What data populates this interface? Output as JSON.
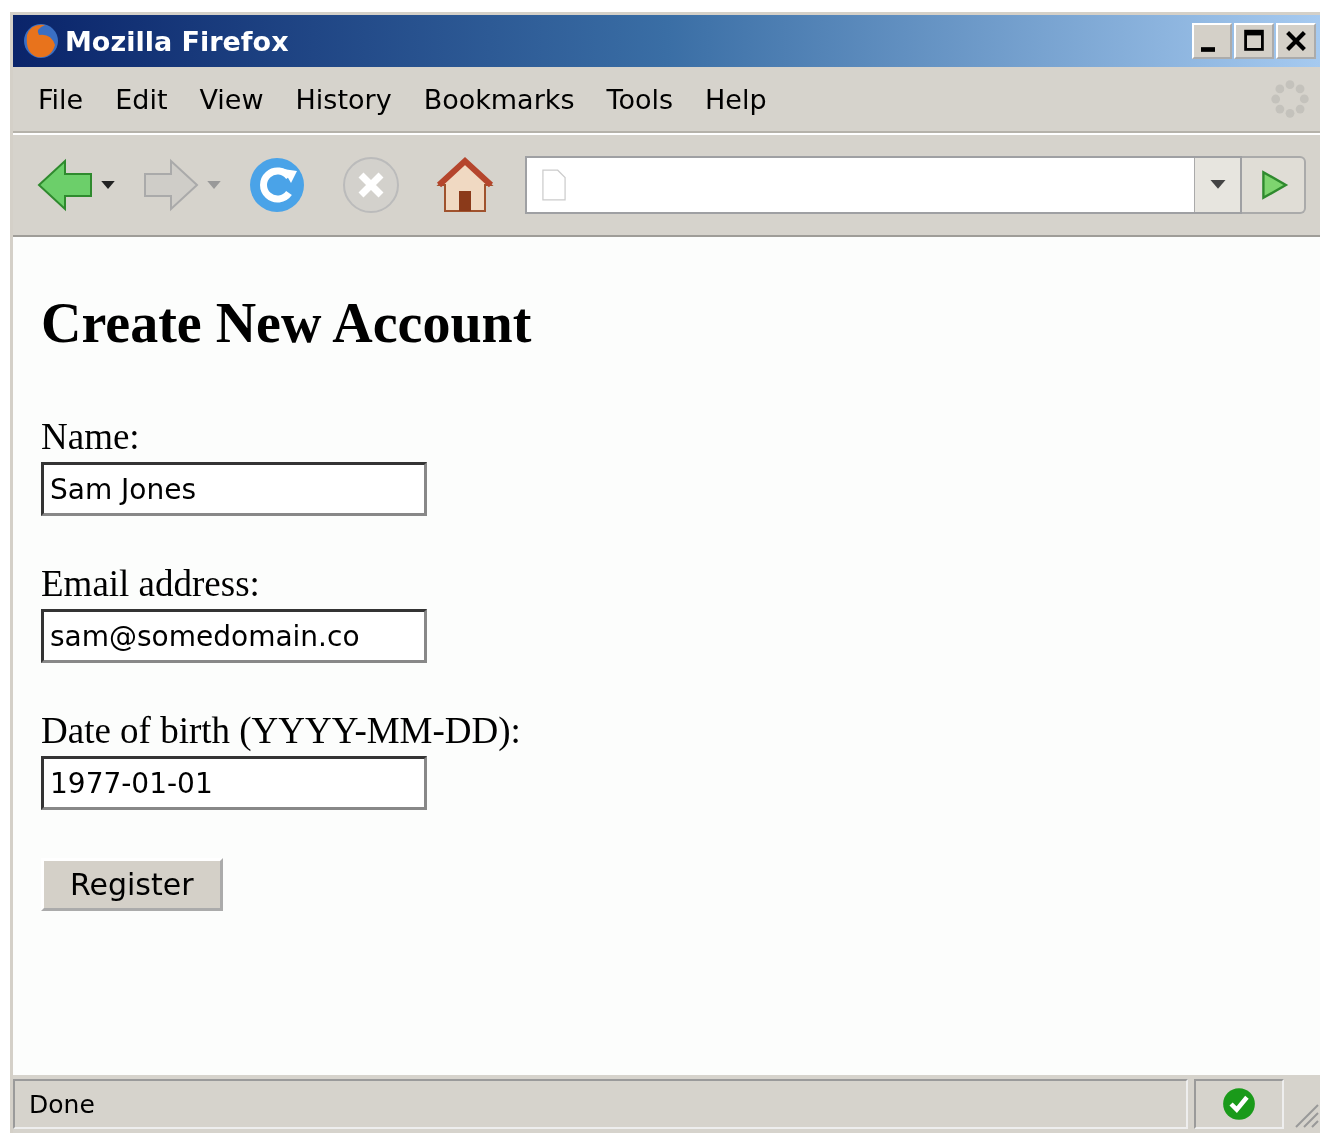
{
  "window": {
    "title": "Mozilla Firefox"
  },
  "menu": [
    "File",
    "Edit",
    "View",
    "History",
    "Bookmarks",
    "Tools",
    "Help"
  ],
  "toolbar": [
    {
      "kind": "back",
      "disabled": false
    },
    {
      "kind": "forward",
      "disabled": true
    },
    {
      "kind": "reload",
      "disabled": false
    },
    {
      "kind": "stop",
      "disabled": true
    },
    {
      "kind": "home",
      "disabled": false
    }
  ],
  "page": {
    "heading": "Create New Account",
    "fields": [
      {
        "label": "Name:",
        "value": "Sam Jones"
      },
      {
        "label": "Email address:",
        "value": "sam@somedomain.co"
      },
      {
        "label": "Date of birth (YYYY-MM-DD):",
        "value": "1977-01-01"
      }
    ],
    "button": "Register"
  },
  "status_bar": {
    "text": "Done"
  }
}
